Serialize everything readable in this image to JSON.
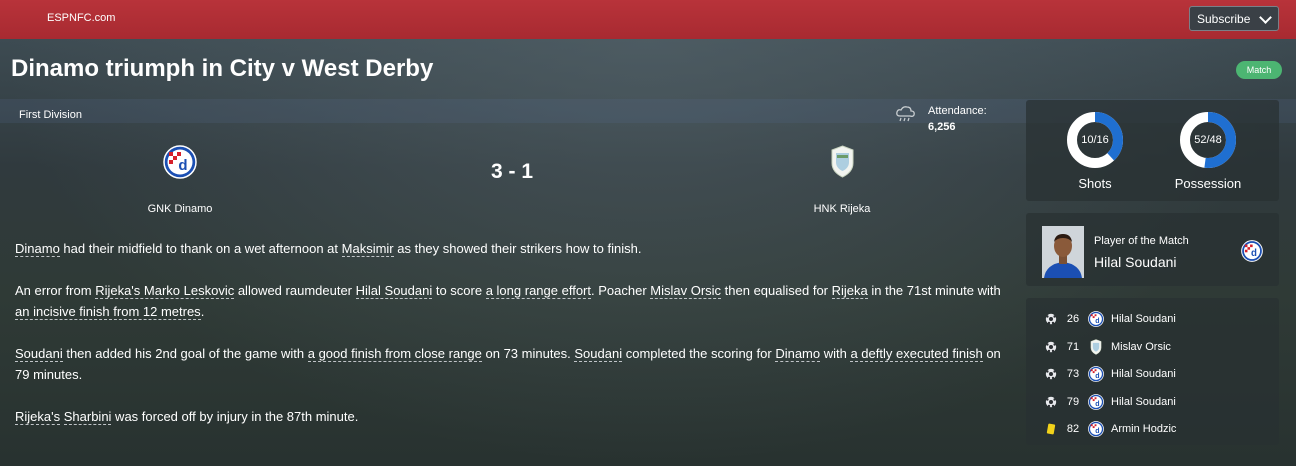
{
  "brand": "ESPNFC.com",
  "subscribe_label": "Subscribe",
  "headline": "Dinamo triumph in City v West Derby",
  "badge": "Match",
  "division": "First Division",
  "attendance": {
    "label": "Attendance:",
    "value": "6,256"
  },
  "match": {
    "home": "GNK Dinamo",
    "away": "HNK Rijeka",
    "score": "3 - 1"
  },
  "report": {
    "p1": {
      "a": "Dinamo",
      "b": " had their midfield to thank on a wet afternoon at ",
      "c": "Maksimir",
      "d": " as they showed their strikers how to finish."
    },
    "p2": {
      "a": "An error from ",
      "b": "Rijeka's Marko Leskovic",
      "c": " allowed raumdeuter ",
      "d": "Hilal Soudani",
      "e": " to score ",
      "f": "a long range effort",
      "g": ". Poacher ",
      "h": "Mislav Orsic",
      "i": " then equalised for ",
      "j": "Rijeka",
      "k": " in the 71st minute with ",
      "l": "an incisive finish from 12 metres",
      "m": "."
    },
    "p3": {
      "a": "Soudani",
      "b": " then added his 2nd goal of the game with ",
      "c": "a good finish from close range",
      "d": " on 73 minutes. ",
      "e": "Soudani",
      "f": " completed the scoring for ",
      "g": "Dinamo",
      "h": " with ",
      "i": "a deftly executed finish",
      "j": " on 79 minutes."
    },
    "p4": {
      "a": "Rijeka's",
      "b": " ",
      "c": "Sharbini",
      "d": " was forced off by injury in the 87th minute."
    }
  },
  "stats": {
    "shots": {
      "label": "Shots",
      "value": "10/16",
      "home_share": 0.38
    },
    "possession": {
      "label": "Possession",
      "value": "52/48",
      "home_share": 0.52
    }
  },
  "potm": {
    "label": "Player of the Match",
    "name": "Hilal Soudani"
  },
  "events": [
    {
      "icon": "ball-icon",
      "minute": "26",
      "team": "dinamo",
      "player": "Hilal Soudani"
    },
    {
      "icon": "ball-icon",
      "minute": "71",
      "team": "rijeka",
      "player": "Mislav Orsic"
    },
    {
      "icon": "ball-icon",
      "minute": "73",
      "team": "dinamo",
      "player": "Hilal Soudani"
    },
    {
      "icon": "ball-icon",
      "minute": "79",
      "team": "dinamo",
      "player": "Hilal Soudani"
    },
    {
      "icon": "yellow-card-icon",
      "minute": "82",
      "team": "dinamo",
      "player": "Armin Hodzic"
    }
  ],
  "colors": {
    "topbar": "#b8333a",
    "accent_blue": "#1f6fd1",
    "match_badge": "#4cb572",
    "yellow_card": "#f2d21a"
  }
}
